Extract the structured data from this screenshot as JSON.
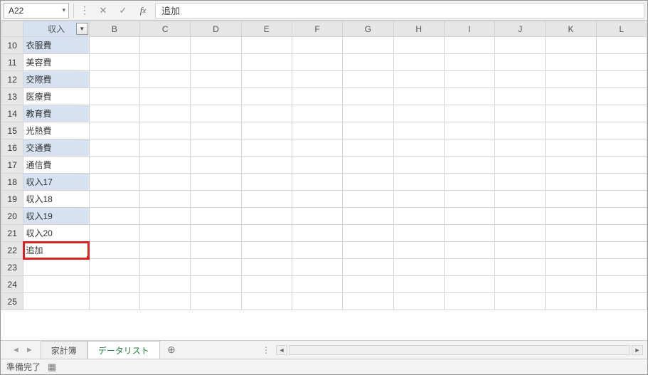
{
  "name_box": "A22",
  "formula_value": "追加",
  "columns": [
    "収入",
    "B",
    "C",
    "D",
    "E",
    "F",
    "G",
    "H",
    "I",
    "J",
    "K",
    "L"
  ],
  "rows": [
    {
      "n": 10,
      "a": "衣服費",
      "shaded": true
    },
    {
      "n": 11,
      "a": "美容費",
      "shaded": false
    },
    {
      "n": 12,
      "a": "交際費",
      "shaded": true
    },
    {
      "n": 13,
      "a": "医療費",
      "shaded": false
    },
    {
      "n": 14,
      "a": "教育費",
      "shaded": true
    },
    {
      "n": 15,
      "a": "光熱費",
      "shaded": false
    },
    {
      "n": 16,
      "a": "交通費",
      "shaded": true
    },
    {
      "n": 17,
      "a": "通信費",
      "shaded": false
    },
    {
      "n": 18,
      "a": "収入17",
      "shaded": true
    },
    {
      "n": 19,
      "a": "収入18",
      "shaded": false
    },
    {
      "n": 20,
      "a": "収入19",
      "shaded": true
    },
    {
      "n": 21,
      "a": "収入20",
      "shaded": false
    },
    {
      "n": 22,
      "a": "追加",
      "shaded": false,
      "highlight": true
    },
    {
      "n": 23,
      "a": "",
      "shaded": false
    },
    {
      "n": 24,
      "a": "",
      "shaded": false
    },
    {
      "n": 25,
      "a": "",
      "shaded": false
    }
  ],
  "tabs": [
    {
      "label": "家計簿",
      "active": false
    },
    {
      "label": "データリスト",
      "active": true
    }
  ],
  "status": {
    "text": "準備完了"
  }
}
